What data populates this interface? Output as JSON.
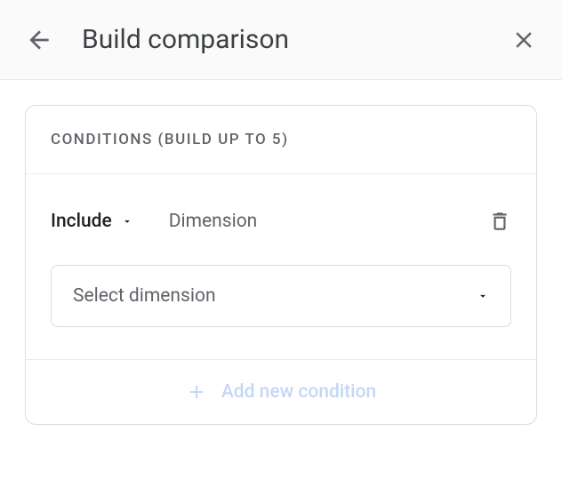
{
  "header": {
    "title": "Build comparison"
  },
  "card": {
    "header_label": "CONDITIONS (BUILD UP TO 5)",
    "condition": {
      "include_label": "Include",
      "dimension_label": "Dimension",
      "select_placeholder": "Select dimension"
    },
    "add_button_label": "Add new condition"
  }
}
